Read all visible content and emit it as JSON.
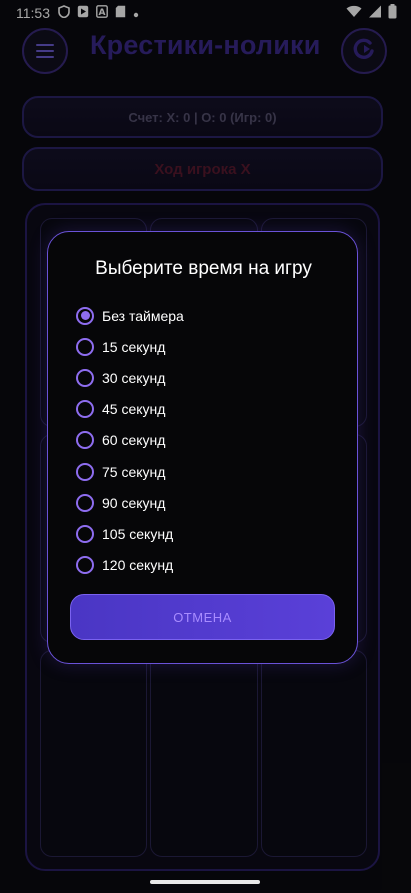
{
  "status_bar": {
    "time": "11:53",
    "icons": [
      "shield-icon",
      "play-icon",
      "font-icon",
      "sd-card-icon",
      "dot-icon"
    ],
    "right_icons": [
      "wifi-icon",
      "signal-icon",
      "battery-icon"
    ]
  },
  "header": {
    "title": "Крестики-нолики",
    "menu_icon": "hamburger-icon",
    "reset_icon": "restart-icon"
  },
  "score": {
    "text": "Счет: X: 0 | O: 0 (Игр: 0)"
  },
  "turn": {
    "text": "Ход игрока X"
  },
  "dialog": {
    "title": "Выберите время на игру",
    "options": [
      {
        "label": "Без таймера",
        "selected": true
      },
      {
        "label": "15 секунд",
        "selected": false
      },
      {
        "label": "30 секунд",
        "selected": false
      },
      {
        "label": "45 секунд",
        "selected": false
      },
      {
        "label": "60 секунд",
        "selected": false
      },
      {
        "label": "75 секунд",
        "selected": false
      },
      {
        "label": "90 секунд",
        "selected": false
      },
      {
        "label": "105 секунд",
        "selected": false
      },
      {
        "label": "120 секунд",
        "selected": false
      }
    ],
    "cancel_label": "ОТМЕНА"
  },
  "colors": {
    "accent": "#8e6df0",
    "background": "#0a0a10",
    "title": "#3b2a8a",
    "button": "#4a36c4"
  }
}
